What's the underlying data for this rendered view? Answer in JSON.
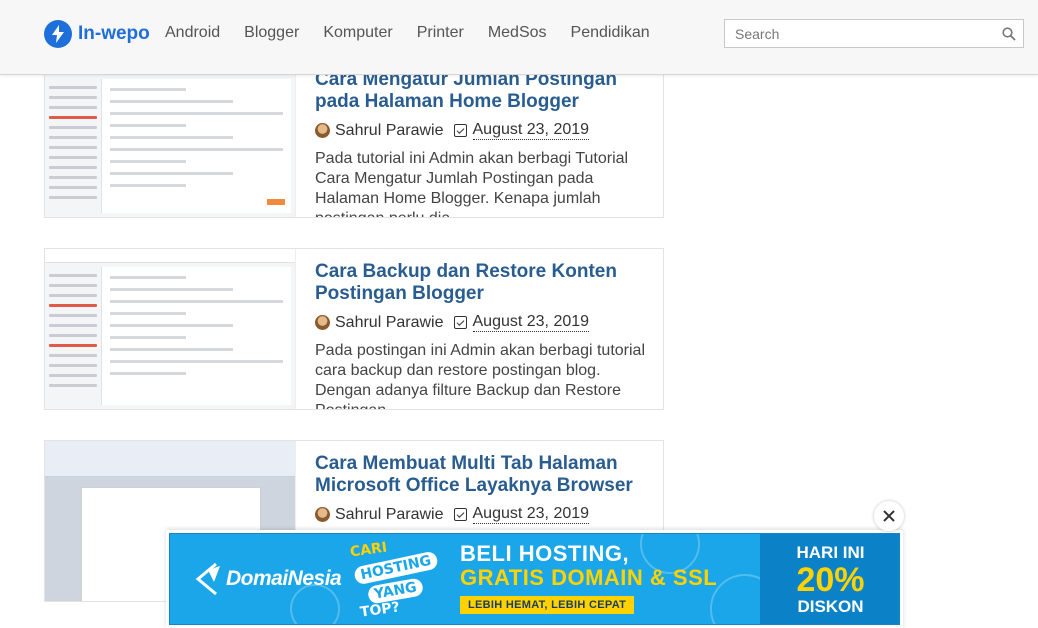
{
  "header": {
    "logo_text": "In-wepo",
    "nav": [
      "Android",
      "Blogger",
      "Komputer",
      "Printer",
      "MedSos",
      "Pendidikan"
    ],
    "search_placeholder": "Search"
  },
  "posts": [
    {
      "title": "Cara Mengatur Jumlah Postingan pada Halaman Home Blogger",
      "author": "Sahrul Parawie",
      "date": "August 23, 2019",
      "excerpt": "Pada tutorial ini Admin akan berbagi Tutorial Cara Mengatur Jumlah Postingan pada Halaman Home Blogger. Kenapa jumlah postingan perlu dia..."
    },
    {
      "title": "Cara Backup dan Restore Konten Postingan Blogger",
      "author": "Sahrul Parawie",
      "date": "August 23, 2019",
      "excerpt": "Pada postingan ini Admin akan berbagi tutorial cara backup dan restore postingan blog. Dengan adanya filture Backup dan Restore Postingan..."
    },
    {
      "title": "Cara Membuat Multi Tab Halaman Microsoft Office Layaknya Browser",
      "author": "Sahrul Parawie",
      "date": "August 23, 2019",
      "excerpt": ""
    }
  ],
  "ad": {
    "brand": "DomaiNesia",
    "stack": [
      "CARI",
      "HOSTING",
      "YANG",
      "TOP?"
    ],
    "headline_1": "BELI HOSTING,",
    "headline_2": "GRATIS DOMAIN & SSL",
    "sub": "LEBIH HEMAT, LEBIH CEPAT",
    "discount_1": "HARI INI",
    "discount_2": "20%",
    "discount_3": "DISKON"
  },
  "colors": {
    "brand": "#1e6fd9",
    "title": "#2a5d8f",
    "ad_bg": "#1aa6e8",
    "ad_yellow": "#ffd200"
  },
  "icons": [
    "bolt-icon",
    "search-icon",
    "avatar-icon",
    "calendar-check-icon",
    "close-icon",
    "domainesia-logo-icon"
  ]
}
